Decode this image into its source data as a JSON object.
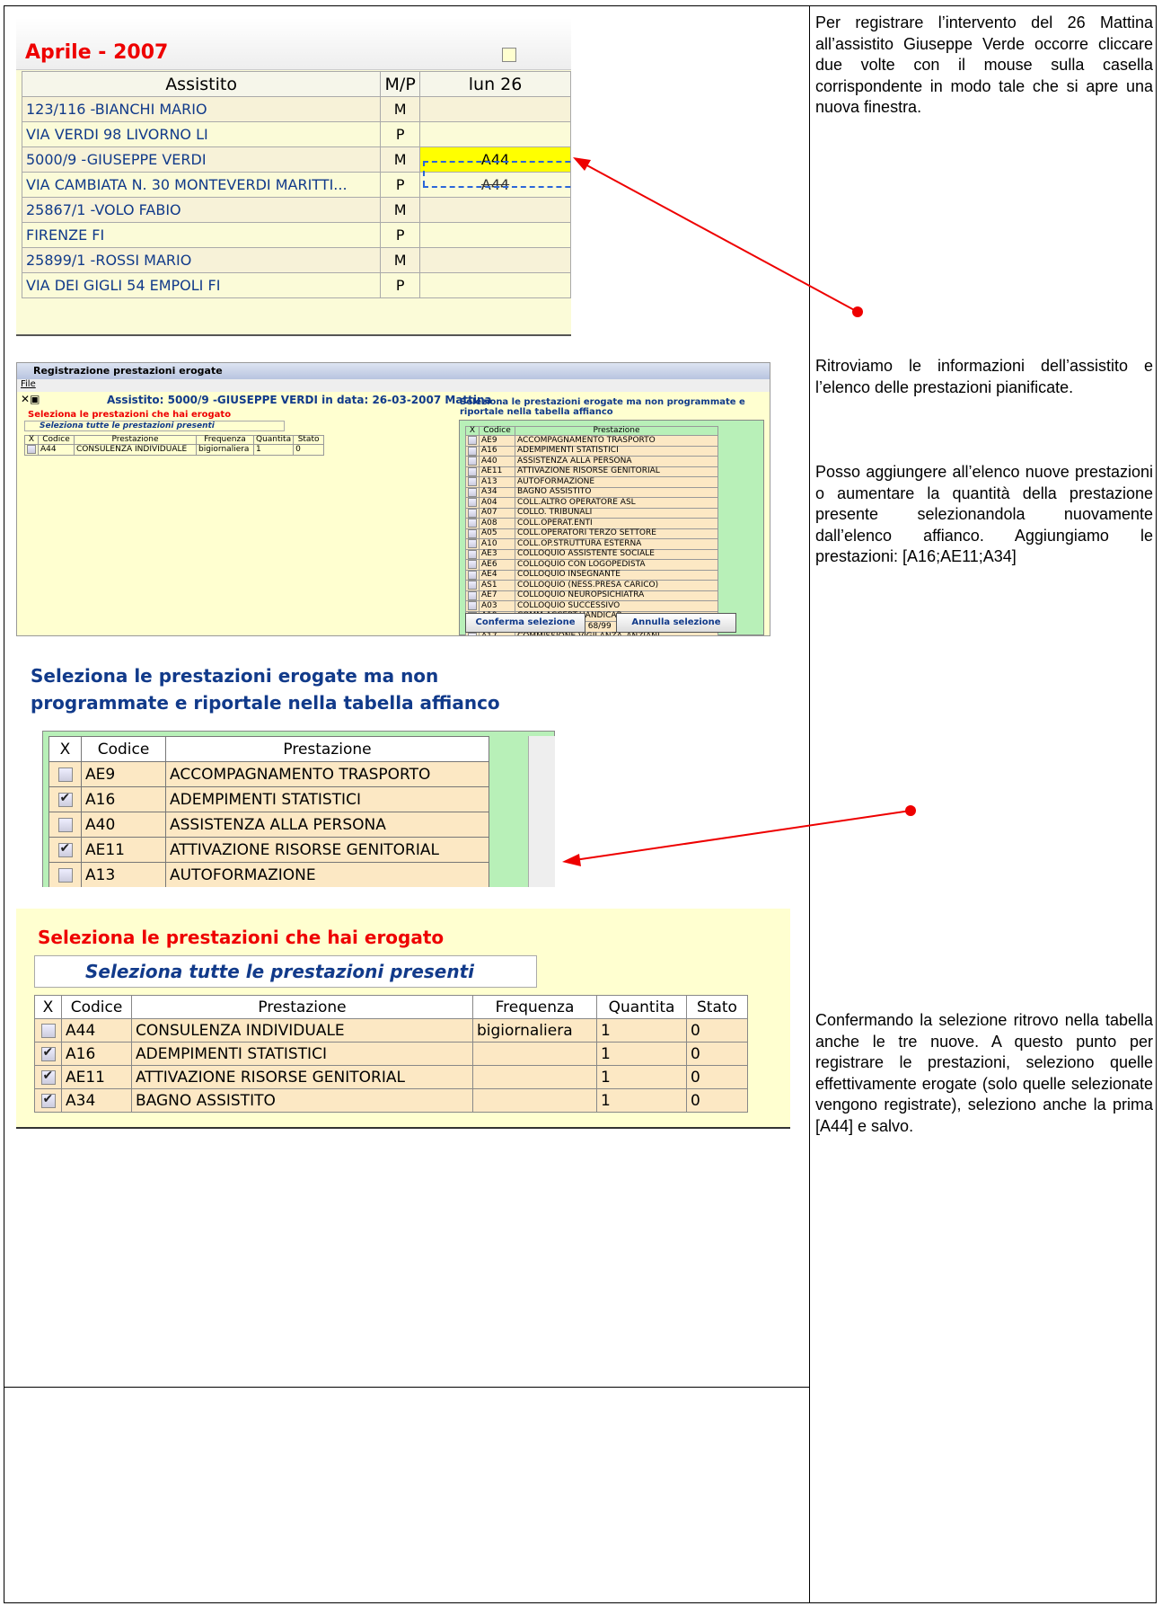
{
  "text_blocks": {
    "p1": "Per registrare l’intervento del 26 Mattina all’assistito Giuseppe Verde occorre cliccare due volte con il mouse sulla casella corrispondente in modo tale che si apre una nuova finestra.",
    "p2": "Ritroviamo le informazioni dell’assistito e l’elenco delle prestazioni pianificate.",
    "p3": "Posso aggiungere all’elenco nuove prestazioni o aumentare la quantità della prestazione presente selezionandola nuovamente dall’elenco affianco. Aggiungiamo le prestazioni: [A16;AE11;A34]",
    "p4": "Confermando la selezione ritrovo nella tabella anche le tre nuove. A questo punto per registrare le prestazioni, seleziono quelle effettivamente erogate (solo quelle selezionate vengono registrate), seleziono anche la prima [A44] e salvo."
  },
  "calendar": {
    "title": "Aprile - 2007",
    "col_assistito": "Assistito",
    "col_mp": "M/P",
    "col_day": "lun 26",
    "rows": [
      {
        "name": "123/116 -BIANCHI MARIO",
        "mp": "M",
        "val": ""
      },
      {
        "name": "VIA VERDI 98 LIVORNO LI",
        "mp": "P",
        "val": ""
      },
      {
        "name": "5000/9 -GIUSEPPE VERDI",
        "mp": "M",
        "val": "A44"
      },
      {
        "name": "VIA CAMBIATA N. 30 MONTEVERDI MARITTI...",
        "mp": "P",
        "val": "A44"
      },
      {
        "name": "25867/1 -VOLO FABIO",
        "mp": "M",
        "val": ""
      },
      {
        "name": "FIRENZE FI",
        "mp": "P",
        "val": ""
      },
      {
        "name": "25899/1 -ROSSI MARIO",
        "mp": "M",
        "val": ""
      },
      {
        "name": "VIA DEI GIGLI 54 EMPOLI FI",
        "mp": "P",
        "val": ""
      }
    ]
  },
  "dialog": {
    "window_title": "Registrazione prestazioni erogate",
    "menu_file": "File",
    "assistito": "Assistito: 5000/9 -GIUSEPPE VERDI in data: 26-03-2007 Mattina",
    "select_label": "Seleziona le prestazioni che hai erogato",
    "select_all": "Seleziona tutte le prestazioni presenti",
    "left_headers": [
      "X",
      "Codice",
      "Prestazione",
      "Frequenza",
      "Quantita",
      "Stato"
    ],
    "left_row": {
      "code": "A44",
      "name": "CONSULENZA INDIVIDUALE",
      "freq": "bigiornaliera",
      "qty": "1",
      "state": "0"
    },
    "right_title": "Seleziona le prestazioni erogate ma non programmate e riportale nella tabella affianco",
    "right_headers": [
      "X",
      "Codice",
      "Prestazione"
    ],
    "right_rows": [
      {
        "code": "AE9",
        "name": "ACCOMPAGNAMENTO TRASPORTO"
      },
      {
        "code": "A16",
        "name": "ADEMPIMENTI STATISTICI"
      },
      {
        "code": "A40",
        "name": "ASSISTENZA ALLA PERSONA"
      },
      {
        "code": "AE11",
        "name": "ATTIVAZIONE RISORSE GENITORIAL"
      },
      {
        "code": "A13",
        "name": "AUTOFORMAZIONE"
      },
      {
        "code": "A34",
        "name": "BAGNO ASSISTITO"
      },
      {
        "code": "A04",
        "name": "COLL.ALTRO OPERATORE ASL"
      },
      {
        "code": "A07",
        "name": "COLLO. TRIBUNALI"
      },
      {
        "code": "A08",
        "name": "COLL.OPERAT.ENTI"
      },
      {
        "code": "A05",
        "name": "COLL.OPERATORI TERZO SETTORE"
      },
      {
        "code": "A10",
        "name": "COLL.OP.STRUTTURA ESTERNA"
      },
      {
        "code": "AE3",
        "name": "COLLOQUIO ASSISTENTE SOCIALE"
      },
      {
        "code": "AE6",
        "name": "COLLOQUIO CON LOGOPEDISTA"
      },
      {
        "code": "AE4",
        "name": "COLLOQUIO INSEGNANTE"
      },
      {
        "code": "AS1",
        "name": "COLLOQUIO (NESS.PRESA CARICO)"
      },
      {
        "code": "AE7",
        "name": "COLLOQUIO NEUROPSICHIATRA"
      },
      {
        "code": "A03",
        "name": "COLLOQUIO SUCCESSIVO"
      },
      {
        "code": "A19",
        "name": "COMM.ACCERT.HANDICAP"
      },
      {
        "code": "A42",
        "name": "COMMISSIONE L. 68/99"
      },
      {
        "code": "A17",
        "name": "COMMISSIONE VIGILANZA_ANZIANI-"
      }
    ],
    "btn_confirm": "Conferma selezione",
    "btn_cancel": "Annulla selezione"
  },
  "zoom_right": {
    "title": "Seleziona le prestazioni erogate ma non programmate e riportale nella tabella affianco",
    "headers": [
      "X",
      "Codice",
      "Prestazione"
    ],
    "rows": [
      {
        "code": "AE9",
        "name": "ACCOMPAGNAMENTO TRASPORTO",
        "checked": false
      },
      {
        "code": "A16",
        "name": "ADEMPIMENTI STATISTICI",
        "checked": true
      },
      {
        "code": "A40",
        "name": "ASSISTENZA ALLA PERSONA",
        "checked": false
      },
      {
        "code": "AE11",
        "name": "ATTIVAZIONE RISORSE GENITORIAL",
        "checked": true
      },
      {
        "code": "A13",
        "name": "AUTOFORMAZIONE",
        "checked": false
      },
      {
        "code": "A34",
        "name": "BAGNO ASSISTITO",
        "checked": true
      },
      {
        "code": "A04",
        "name": "COLL.ALTRO OPERATORE ASL",
        "checked": false
      },
      {
        "code": "A07",
        "name": "COLLO. TRIBUNALI",
        "checked": false
      }
    ]
  },
  "final_table": {
    "title": "Seleziona le prestazioni che hai erogato",
    "select_all": "Seleziona tutte le prestazioni presenti",
    "headers": [
      "X",
      "Codice",
      "Prestazione",
      "Frequenza",
      "Quantita",
      "Stato"
    ],
    "rows": [
      {
        "code": "A44",
        "name": "CONSULENZA INDIVIDUALE",
        "freq": "bigiornaliera",
        "qty": "1",
        "state": "0",
        "checked": false
      },
      {
        "code": "A16",
        "name": "ADEMPIMENTI STATISTICI",
        "freq": "",
        "qty": "1",
        "state": "0",
        "checked": true
      },
      {
        "code": "AE11",
        "name": "ATTIVAZIONE RISORSE GENITORIAL",
        "freq": "",
        "qty": "1",
        "state": "0",
        "checked": true
      },
      {
        "code": "A34",
        "name": "BAGNO ASSISTITO",
        "freq": "",
        "qty": "1",
        "state": "0",
        "checked": true
      }
    ]
  }
}
